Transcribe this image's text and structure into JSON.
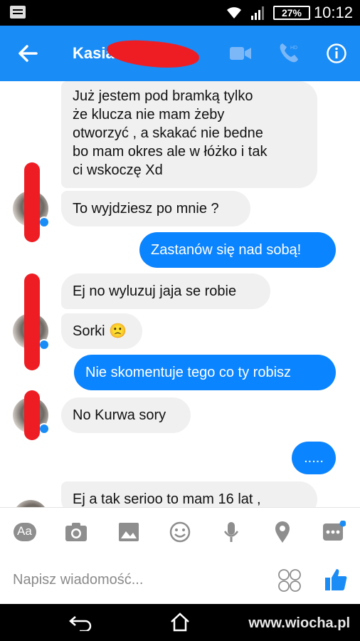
{
  "status_bar": {
    "battery": "27%",
    "time": "10:12"
  },
  "header": {
    "contact_name": "Kasia"
  },
  "messages": [
    {
      "direction": "incoming",
      "lines": [
        "Już jestem pod bramką tylko",
        "że klucza nie mam żeby",
        "otworzyć , a skakać nie bedne",
        "bo mam okres ale w łóżko i tak",
        "ci wskoczę Xd"
      ]
    },
    {
      "direction": "incoming",
      "text": "To wyjdziesz po mnie ?"
    },
    {
      "direction": "outgoing",
      "text": "Zastanów się nad sobą!"
    },
    {
      "direction": "incoming",
      "text": "Ej no wyluzuj jaja se robie"
    },
    {
      "direction": "incoming",
      "text": "Sorki 🙁"
    },
    {
      "direction": "outgoing",
      "text": "Nie skomentuje tego co ty robisz"
    },
    {
      "direction": "incoming",
      "text": "No Kurwa sory"
    },
    {
      "direction": "outgoing",
      "text": "....."
    },
    {
      "direction": "incoming",
      "text": "Ej a tak serioo to mam 16 lat ,"
    }
  ],
  "composer": {
    "placeholder": "Napisz wiadomość...",
    "aa_label": "Aa",
    "icons": [
      "aa-icon",
      "camera-icon",
      "gallery-icon",
      "smiley-icon",
      "microphone-icon",
      "location-icon",
      "more-icon"
    ]
  },
  "watermark": {
    "text_main": "www.wi",
    "text_mid": "o",
    "text_end": "cha.pl"
  },
  "colors": {
    "accent": "#1a8cf6",
    "outgoing": "#0b84ff",
    "incoming": "#f0f0f0",
    "redaction": "#ee1d24"
  }
}
